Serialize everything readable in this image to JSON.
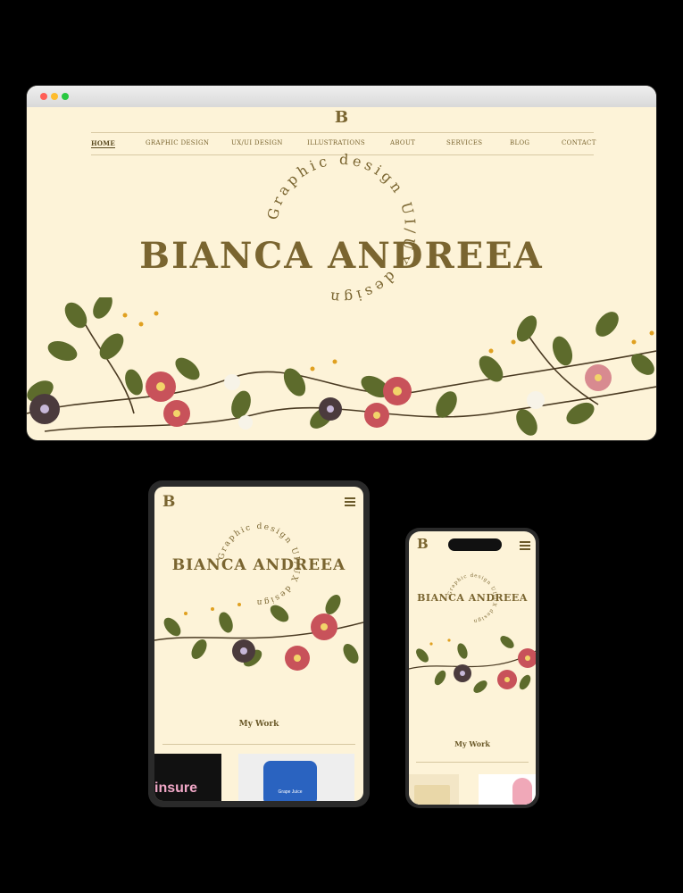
{
  "desktop": {
    "logo": "B",
    "nav": [
      "HOME",
      "GRAPHIC DESIGN",
      "UX/UI DESIGN",
      "ILLUSTRATIONS",
      "ABOUT",
      "SERVICES",
      "BLOG",
      "CONTACT"
    ],
    "title": "BIANCA ANDREEA",
    "circle_text": "Graphic design  UI/UX design"
  },
  "tablet": {
    "logo": "B",
    "title": "BIANCA ANDREEA",
    "circle_text": "Graphic design  UI/UX design",
    "section": "My Work",
    "thumb1_text": "insure",
    "thumb2_text": "Grape Juice"
  },
  "phone": {
    "logo": "B",
    "title": "BIANCA ANDREEA",
    "circle_text": "Graphic design  UI/UX design",
    "section": "My Work"
  },
  "colors": {
    "cream": "#fdf3d8",
    "gold": "#7a6530",
    "leaf": "#5d6b2c",
    "rose": "#c8525a",
    "plum": "#4b3b3d"
  }
}
